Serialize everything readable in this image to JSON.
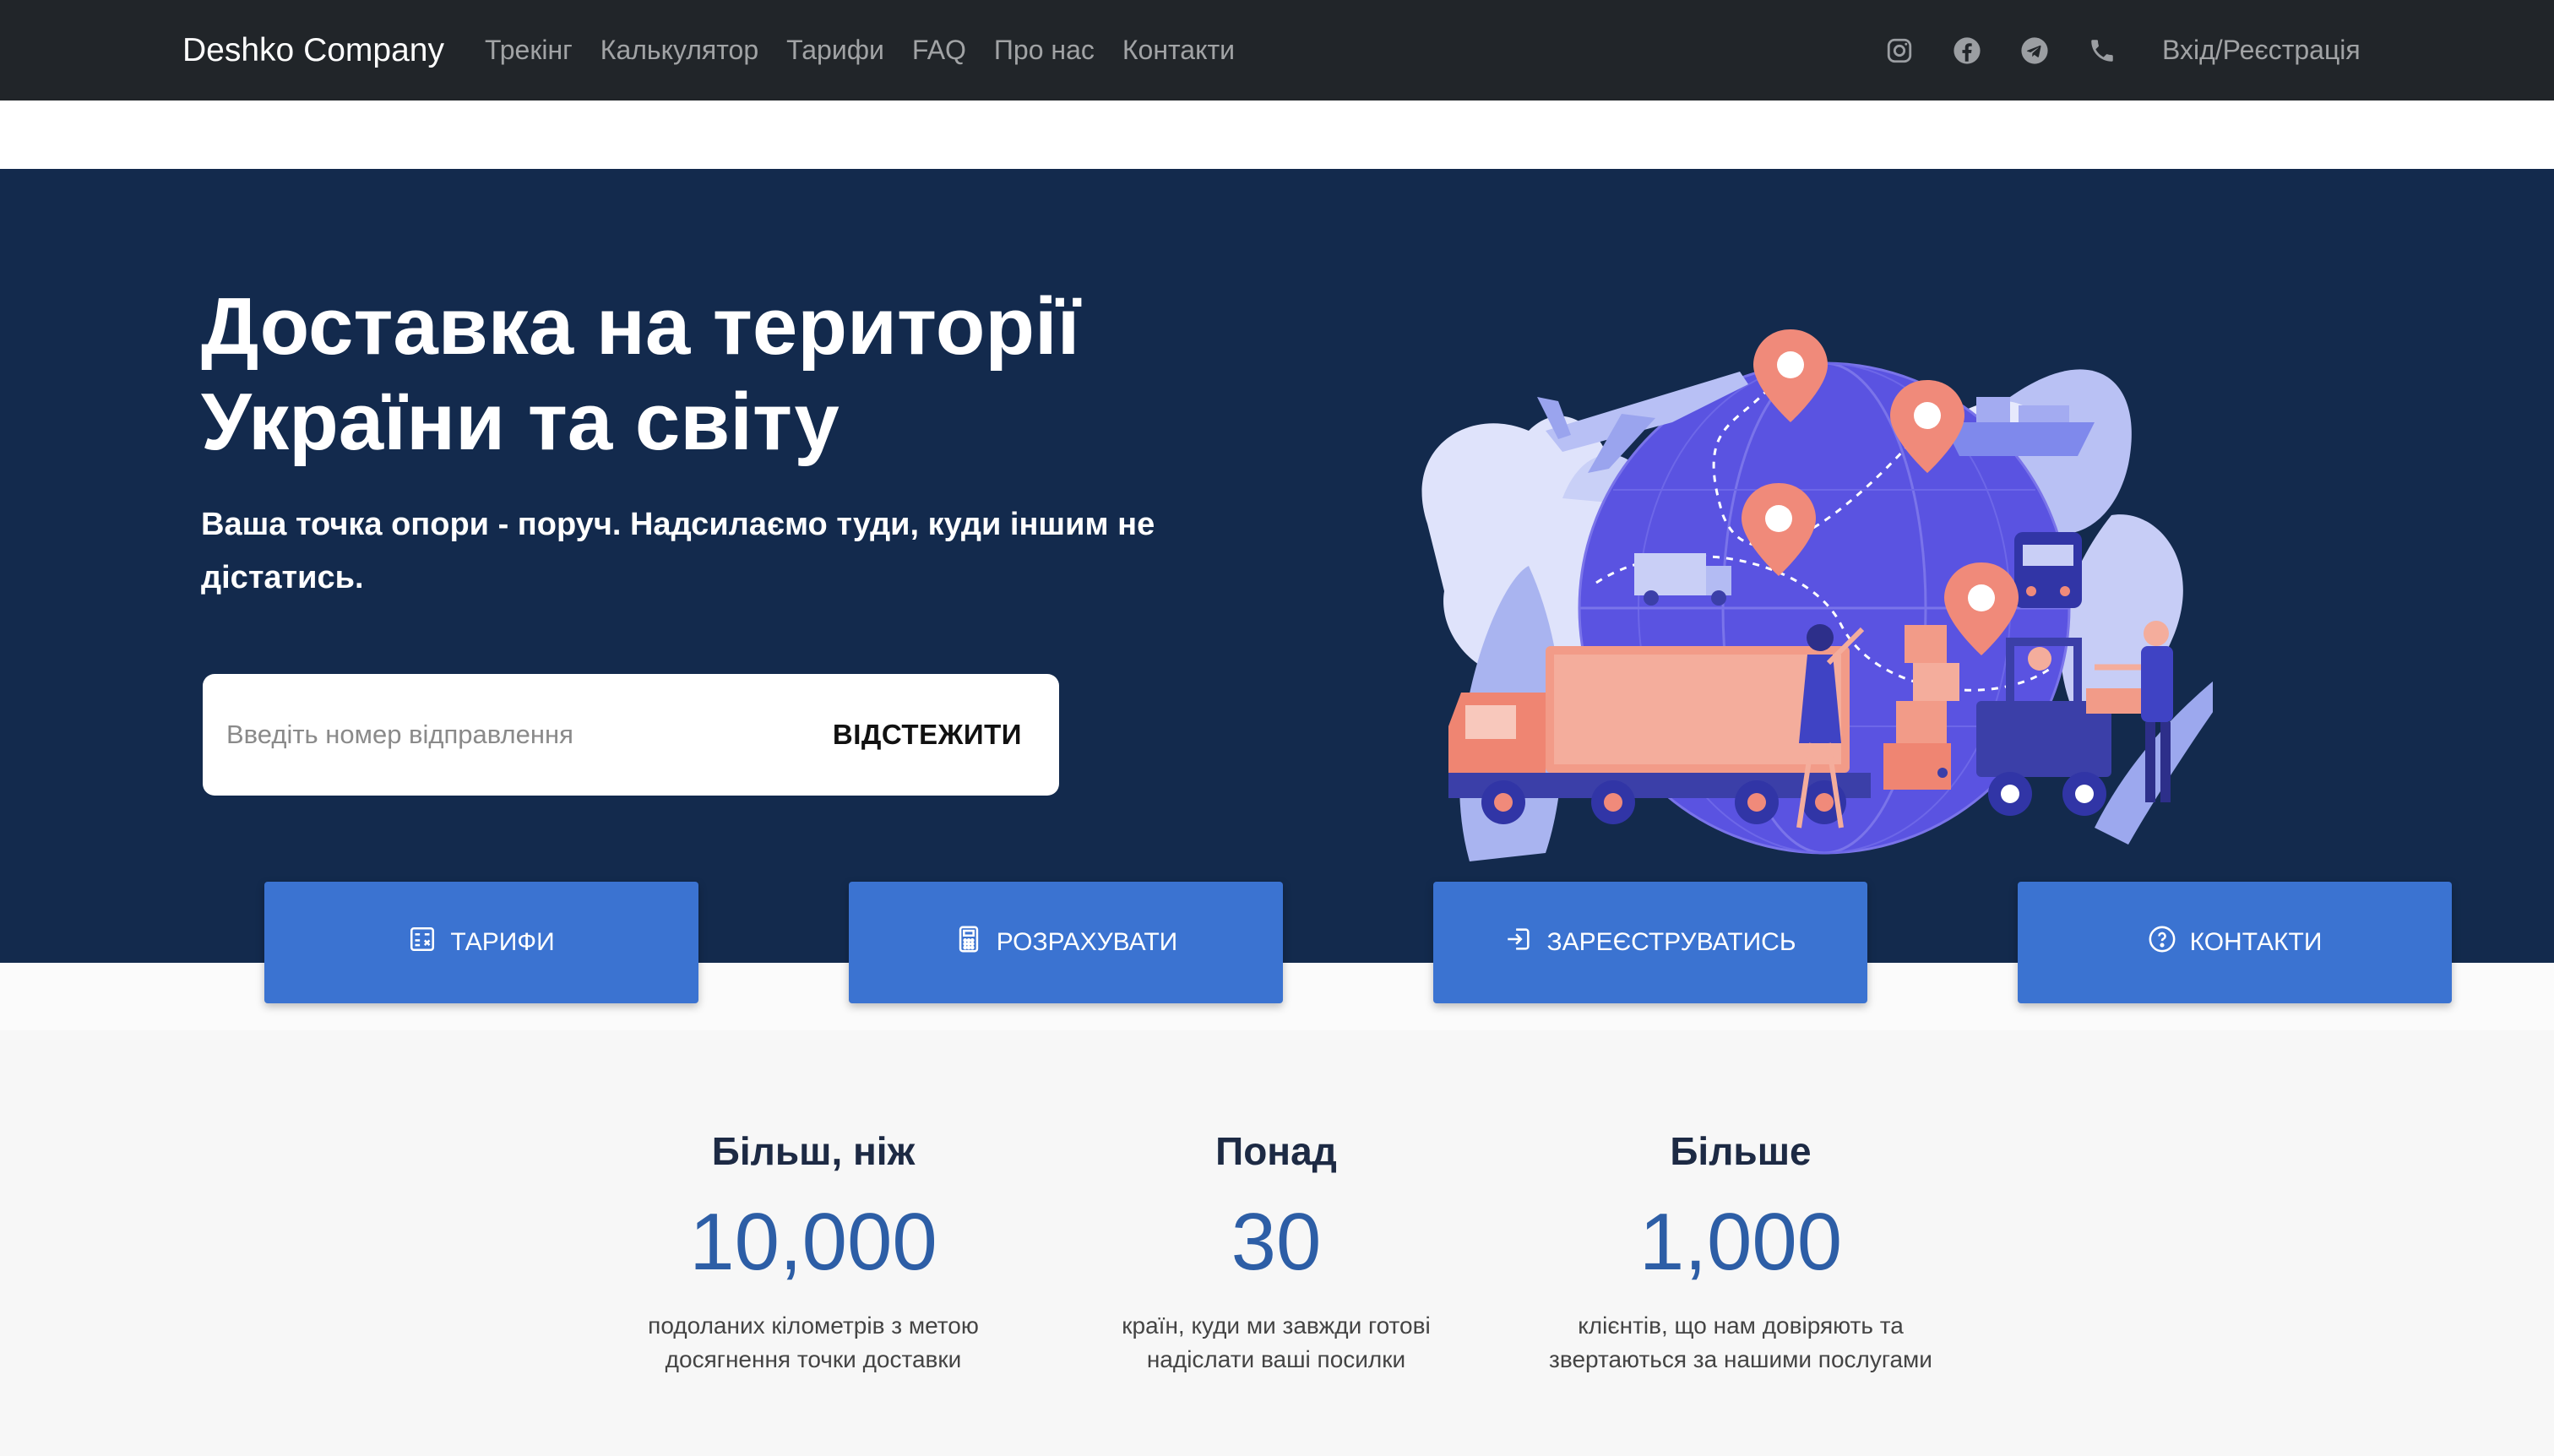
{
  "nav": {
    "brand": "Deshko Company",
    "links": [
      "Трекінг",
      "Калькулятор",
      "Тарифи",
      "FAQ",
      "Про нас",
      "Контакти"
    ],
    "icons": [
      "instagram-icon",
      "facebook-icon",
      "telegram-icon",
      "phone-icon"
    ],
    "login": "Вхід/Реєстрація"
  },
  "hero": {
    "title": "Доставка на території України та світу",
    "subtitle": "Ваша точка опори - поруч. Надсилаємо туди, куди іншим не дістатись.",
    "track_placeholder": "Введіть номер відправлення",
    "track_button": "ВІДСТЕЖИТИ"
  },
  "actions": [
    {
      "label": "ТАРИФИ",
      "icon": "tariffs-icon"
    },
    {
      "label": "РОЗРАХУВАТИ",
      "icon": "calculator-icon"
    },
    {
      "label": "ЗАРЕЄСТРУВАТИСЬ",
      "icon": "sign-in-icon"
    },
    {
      "label": "КОНТАКТИ",
      "icon": "question-circle-icon"
    }
  ],
  "stats": [
    {
      "head": "Більш, ніж",
      "num": "10,000",
      "desc": "подоланих кілометрів з метою досягнення точки доставки"
    },
    {
      "head": "Понад",
      "num": "30",
      "desc": "країн, куди ми завжди готові надіслати ваші посилки"
    },
    {
      "head": "Більше",
      "num": "1,000",
      "desc": "клієнтів, що нам довіряють та звертаються за нашими послугами"
    }
  ],
  "colors": {
    "navbar": "#212529",
    "hero_bg": "#132a4d",
    "accent": "#3b73d1",
    "stat_number": "#2d5ea6"
  }
}
